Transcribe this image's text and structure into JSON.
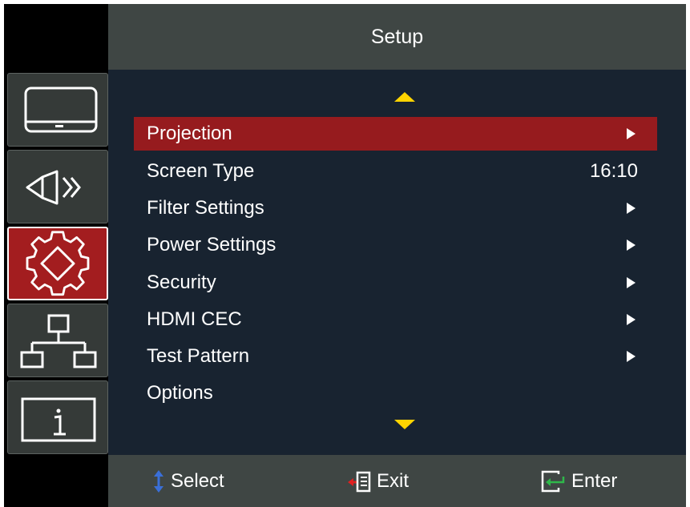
{
  "header": {
    "title": "Setup"
  },
  "sidebar": {
    "tabs": [
      {
        "icon": "display-icon",
        "active": false
      },
      {
        "icon": "audio-icon",
        "active": false
      },
      {
        "icon": "gear-icon",
        "active": true
      },
      {
        "icon": "network-icon",
        "active": false
      },
      {
        "icon": "info-icon",
        "active": false
      }
    ]
  },
  "menu": {
    "scroll_up_icon": "triangle-up-icon",
    "scroll_down_icon": "triangle-down-icon",
    "items": [
      {
        "label": "Projection",
        "value": "",
        "has_submenu": true,
        "selected": true
      },
      {
        "label": "Screen Type",
        "value": "16:10",
        "has_submenu": false,
        "selected": false
      },
      {
        "label": "Filter Settings",
        "value": "",
        "has_submenu": true,
        "selected": false
      },
      {
        "label": "Power Settings",
        "value": "",
        "has_submenu": true,
        "selected": false
      },
      {
        "label": "Security",
        "value": "",
        "has_submenu": true,
        "selected": false
      },
      {
        "label": "HDMI CEC",
        "value": "",
        "has_submenu": true,
        "selected": false
      },
      {
        "label": "Test Pattern",
        "value": "",
        "has_submenu": true,
        "selected": false
      },
      {
        "label": "Options",
        "value": "",
        "has_submenu": false,
        "selected": false
      }
    ]
  },
  "footer": {
    "select_label": "Select",
    "exit_label": "Exit",
    "enter_label": "Enter"
  },
  "colors": {
    "header_bg": "#3f4644",
    "content_bg": "#182330",
    "selected_row": "#961b1e",
    "active_tab": "#a31d1f",
    "scroll_arrow": "#ffd400",
    "select_icon": "#3a6fd8",
    "exit_icon": "#e02020",
    "enter_icon": "#2fb84a"
  }
}
